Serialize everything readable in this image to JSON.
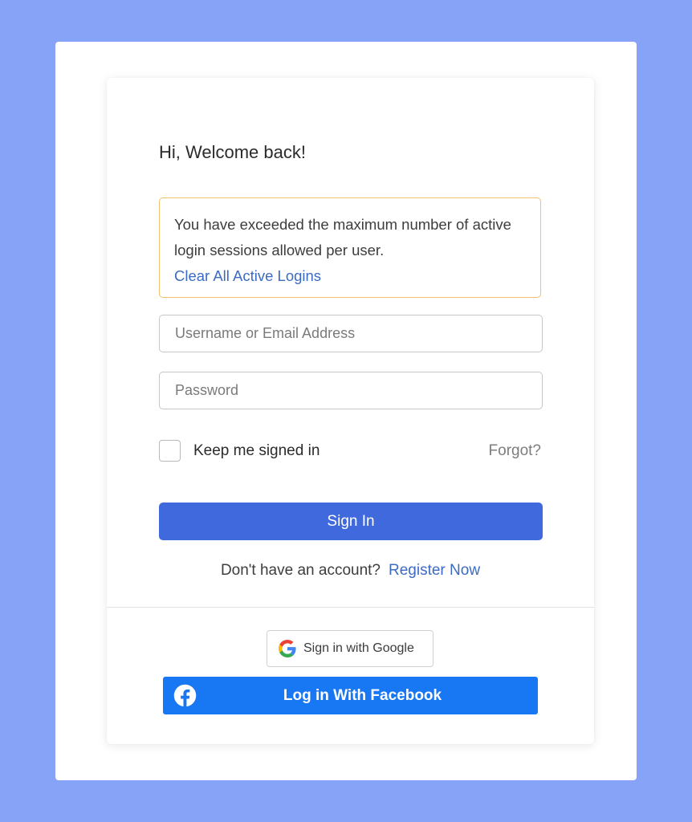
{
  "login": {
    "greeting": "Hi, Welcome back!",
    "alert": {
      "message": "You have exceeded the maximum number of active login sessions allowed per user.",
      "link_label": "Clear All Active Logins"
    },
    "username": {
      "value": "",
      "placeholder": "Username or Email Address"
    },
    "password": {
      "value": "",
      "placeholder": "Password"
    },
    "keep_signed_in": {
      "label": "Keep me signed in",
      "checked": false
    },
    "forgot_label": "Forgot?",
    "signin_label": "Sign In",
    "register": {
      "prompt": "Don't have an account?",
      "link_label": "Register Now"
    },
    "google": {
      "label": "Sign in with Google",
      "icon": "google-icon"
    },
    "facebook": {
      "label": "Log in With Facebook",
      "icon": "facebook-icon"
    }
  },
  "colors": {
    "page_background": "#86a3f8",
    "primary_button": "#4069de",
    "link": "#3c6bc4",
    "alert_border": "#efc26b",
    "facebook_blue": "#1877f2"
  }
}
